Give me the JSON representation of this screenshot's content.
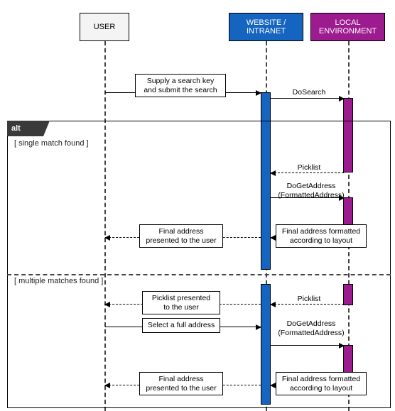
{
  "actors": {
    "user": "USER",
    "website": "WEBSITE /\nINTRANET",
    "env": "LOCAL\nENVIRONMENT"
  },
  "fragment": {
    "kind": "alt",
    "guard_single": "[ single match found ]",
    "guard_multi": "[ multiple matches found ]"
  },
  "messages": {
    "supply": "Supply a search key\nand submit the search",
    "do_search": "DoSearch",
    "picklist": "Picklist",
    "doget": "DoGetAddress\n(FormattedAddress)",
    "final_formatted": "Final address formatted\naccording to layout",
    "final_presented": "Final address\npresented to the user",
    "picklist_presented": "Picklist presented\nto the user",
    "select_full": "Select a full address"
  },
  "chart_data": {
    "type": "sequence-diagram",
    "participants": [
      "USER",
      "WEBSITE / INTRANET",
      "LOCAL ENVIRONMENT"
    ],
    "interactions": [
      {
        "from": "USER",
        "to": "WEBSITE / INTRANET",
        "label": "Supply a search key and submit the search",
        "style": "solid"
      },
      {
        "from": "WEBSITE / INTRANET",
        "to": "LOCAL ENVIRONMENT",
        "label": "DoSearch",
        "style": "solid"
      }
    ],
    "fragment": {
      "type": "alt",
      "operands": [
        {
          "guard": "single match found",
          "interactions": [
            {
              "from": "LOCAL ENVIRONMENT",
              "to": "WEBSITE / INTRANET",
              "label": "Picklist",
              "style": "dashed"
            },
            {
              "from": "WEBSITE / INTRANET",
              "to": "LOCAL ENVIRONMENT",
              "label": "DoGetAddress (FormattedAddress)",
              "style": "solid"
            },
            {
              "from": "LOCAL ENVIRONMENT",
              "to": "WEBSITE / INTRANET",
              "label": "Final address formatted according to layout",
              "style": "dashed"
            },
            {
              "from": "WEBSITE / INTRANET",
              "to": "USER",
              "label": "Final address presented to the user",
              "style": "dashed"
            }
          ]
        },
        {
          "guard": "multiple matches found",
          "interactions": [
            {
              "from": "LOCAL ENVIRONMENT",
              "to": "WEBSITE / INTRANET",
              "label": "Picklist",
              "style": "dashed"
            },
            {
              "from": "WEBSITE / INTRANET",
              "to": "USER",
              "label": "Picklist presented to the user",
              "style": "dashed"
            },
            {
              "from": "USER",
              "to": "WEBSITE / INTRANET",
              "label": "Select a full address",
              "style": "solid"
            },
            {
              "from": "WEBSITE / INTRANET",
              "to": "LOCAL ENVIRONMENT",
              "label": "DoGetAddress (FormattedAddress)",
              "style": "solid"
            },
            {
              "from": "LOCAL ENVIRONMENT",
              "to": "WEBSITE / INTRANET",
              "label": "Final address formatted according to layout",
              "style": "dashed"
            },
            {
              "from": "WEBSITE / INTRANET",
              "to": "USER",
              "label": "Final address presented to the user",
              "style": "dashed"
            }
          ]
        }
      ]
    }
  }
}
